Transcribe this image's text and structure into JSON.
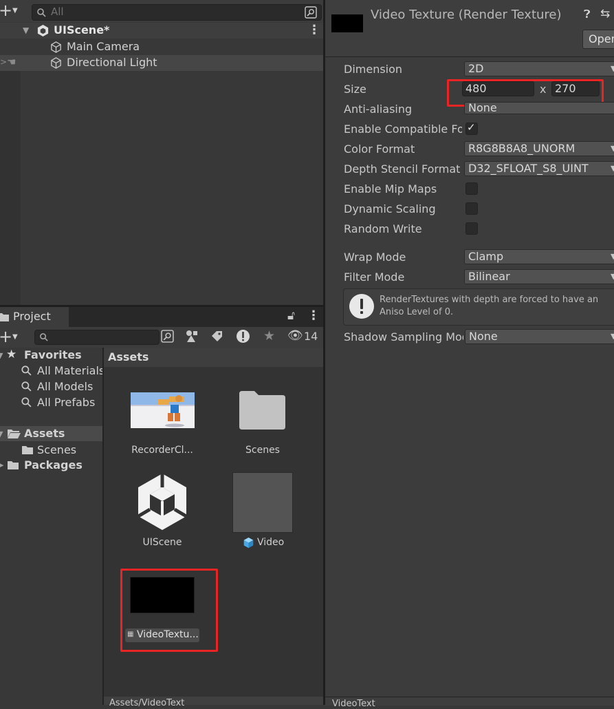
{
  "hierarchy": {
    "search_placeholder": "All",
    "scene_name": "UIScene*",
    "items": [
      {
        "label": "Main Camera"
      },
      {
        "label": "Directional Light"
      }
    ]
  },
  "project": {
    "tab_label": "Project",
    "hidden_count": "14",
    "tree": {
      "favorites_label": "Favorites",
      "favorites": [
        "All Materials",
        "All Models",
        "All Prefabs"
      ],
      "assets_label": "Assets",
      "assets_children": [
        "Scenes"
      ],
      "packages_label": "Packages"
    },
    "grid_header": "Assets",
    "assets": [
      {
        "label": "RecorderCl..."
      },
      {
        "label": "Scenes"
      },
      {
        "label": "UIScene"
      },
      {
        "label": "Video"
      },
      {
        "label": "VideoTextu..."
      }
    ],
    "bottom_path": "Assets/VideoText"
  },
  "inspector": {
    "title": "Video Texture (Render Texture)",
    "open_button": "Open",
    "properties": {
      "dimension_label": "Dimension",
      "dimension_value": "2D",
      "size_label": "Size",
      "size_width": "480",
      "size_x": "x",
      "size_height": "270",
      "anti_aliasing_label": "Anti-aliasing",
      "anti_aliasing_value": "None",
      "enable_compatible_label": "Enable Compatible Format",
      "color_format_label": "Color Format",
      "color_format_value": "R8G8B8A8_UNORM",
      "depth_stencil_label": "Depth Stencil Format",
      "depth_stencil_value": "D32_SFLOAT_S8_UINT",
      "mip_maps_label": "Enable Mip Maps",
      "dynamic_scaling_label": "Dynamic Scaling",
      "random_write_label": "Random Write",
      "wrap_mode_label": "Wrap Mode",
      "wrap_mode_value": "Clamp",
      "filter_mode_label": "Filter Mode",
      "filter_mode_value": "Bilinear",
      "info_line1": "RenderTextures with depth are forced to have an",
      "info_line2": "Aniso Level of 0.",
      "shadow_sampling_label": "Shadow Sampling Mode",
      "shadow_sampling_value": "None"
    },
    "bottom_label": "VideoText"
  },
  "colors": {
    "highlight_red": "#e82424",
    "panel_bg": "#383838",
    "inspector_bg": "#3c3c3c"
  }
}
